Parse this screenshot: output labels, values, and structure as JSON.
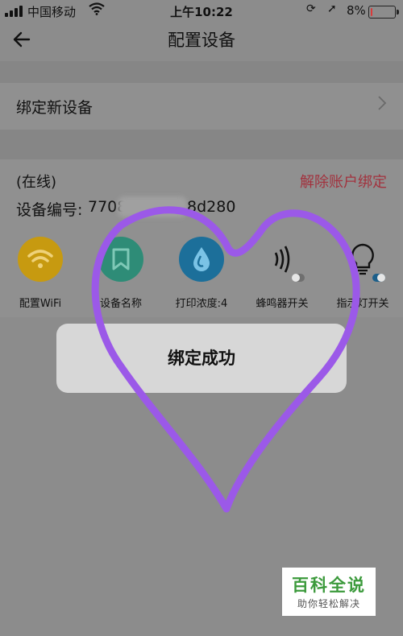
{
  "status_bar": {
    "carrier": "中国移动",
    "time": "上午10:22",
    "battery_percent": "8%",
    "battery_level": 0.08
  },
  "nav": {
    "title": "配置设备"
  },
  "bind_row": {
    "label": "绑定新设备"
  },
  "device": {
    "status": "(在线)",
    "unbind_label": "解除账户绑定",
    "serial_label": "设备编号:",
    "serial_visible_start": "7708",
    "serial_visible_end": "8d280"
  },
  "tiles": [
    {
      "label": "配置WiFi",
      "icon": "wifi-icon"
    },
    {
      "label": "设备名称",
      "icon": "bookmark-icon"
    },
    {
      "label": "打印浓度:4",
      "icon": "water-drop-icon"
    },
    {
      "label": "蜂鸣器开关",
      "icon": "speaker-icon",
      "toggle_on": false
    },
    {
      "label": "指示灯开关",
      "icon": "bulb-icon",
      "toggle_on": true
    }
  ],
  "toast": {
    "message": "绑定成功"
  },
  "watermark": {
    "title": "百科全说",
    "subtitle": "助你轻松解决"
  },
  "colors": {
    "unbind_red": "#a2323e",
    "heart_purple": "#9b59e8",
    "wifi_yellow": "#c79a10",
    "name_green": "#2e8c77",
    "ink_blue": "#1c6f9a"
  }
}
